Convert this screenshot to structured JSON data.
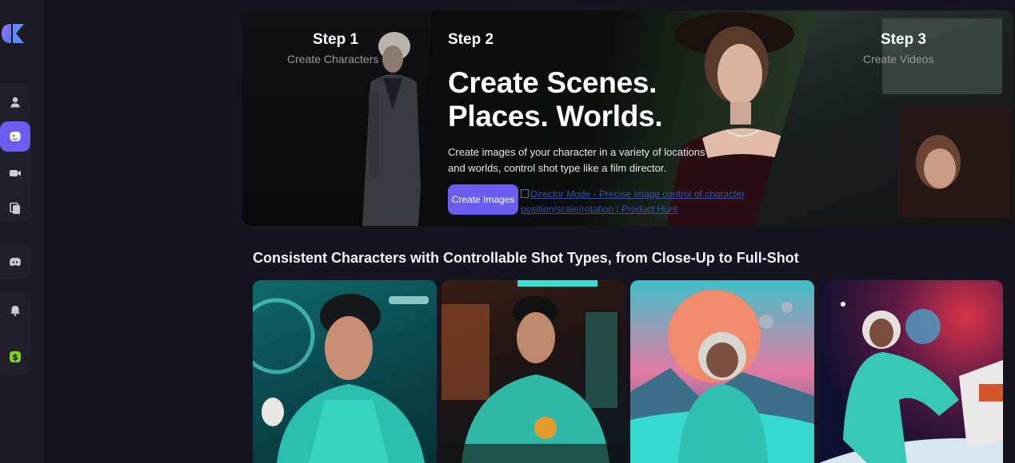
{
  "sidebar": {
    "nav": [
      {
        "icon": "user-icon"
      },
      {
        "icon": "characters-icon",
        "active": true
      },
      {
        "icon": "video-camera-icon"
      },
      {
        "icon": "copy-icon"
      },
      {
        "icon": "discord-icon"
      },
      {
        "icon": "bell-icon"
      },
      {
        "icon": "dollar-icon"
      }
    ],
    "colors": {
      "accent": "#6d5cf0",
      "sidebar_bg": "#1b1a25",
      "dollar": "#7ed321"
    }
  },
  "hero": {
    "step1": {
      "title": "Step 1",
      "subtitle": "Create Characters"
    },
    "step2": {
      "title": "Step 2",
      "heading_line1": "Create Scenes.",
      "heading_line2": "Places. Worlds.",
      "description": "Create images of your character in a variety of locations and worlds, control shot type like a film director.",
      "cta_label": "Create Images",
      "image_alt": "Director Mode - Precise image control of character position/scale/rotation | Product Hunt"
    },
    "step3": {
      "title": "Step 3",
      "subtitle": "Create Videos"
    }
  },
  "section": {
    "title": "Consistent Characters with Controllable Shot Types, from Close-Up to Full-Shot",
    "cards": [
      {
        "alt": "close-up astronaut in spaceship"
      },
      {
        "alt": "medium shot at neon bar"
      },
      {
        "alt": "astronaut on alien planet"
      },
      {
        "alt": "full shot floating in space"
      }
    ]
  }
}
